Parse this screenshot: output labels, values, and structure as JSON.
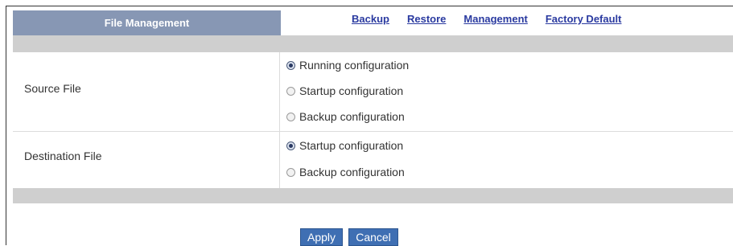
{
  "header": {
    "tab_label": "File Management"
  },
  "links": {
    "backup": "Backup",
    "restore": "Restore",
    "management": "Management",
    "factory_default": "Factory Default"
  },
  "source_file": {
    "label": "Source File",
    "options": [
      {
        "label": "Running configuration",
        "checked": true
      },
      {
        "label": "Startup configuration",
        "checked": false
      },
      {
        "label": "Backup configuration",
        "checked": false
      }
    ]
  },
  "destination_file": {
    "label": "Destination File",
    "options": [
      {
        "label": "Startup configuration",
        "checked": true
      },
      {
        "label": "Backup configuration",
        "checked": false
      }
    ]
  },
  "buttons": {
    "apply": "Apply",
    "cancel": "Cancel"
  }
}
